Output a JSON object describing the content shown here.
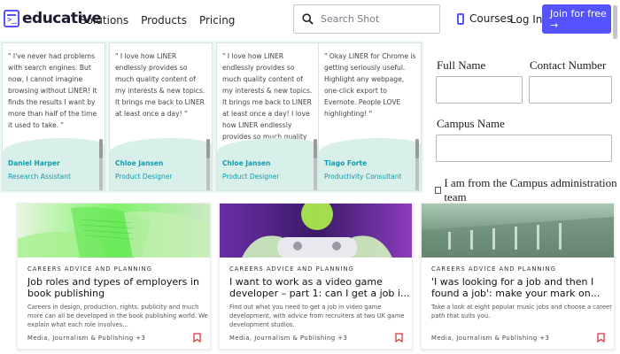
{
  "header": {
    "logo_text": "educative",
    "logo_glyph": ">_",
    "nav": [
      "Solutions",
      "Products",
      "Pricing"
    ],
    "search_placeholder": "Search Shot",
    "courses_label": "Courses",
    "login_label": "Log In",
    "join_label": "Join for free",
    "join_arrow": "→",
    "accent": "#5553ff"
  },
  "testimonials": [
    {
      "quote": "\" I've never had problems with search engines. But now, I cannot imagine browsing without LINER! It finds the results I want by more than half of the time it used to take. \"",
      "name": "Daniel Harper",
      "role": "Research Assistant"
    },
    {
      "quote": "\" I love how LINER endlessly provides so much quality content of my interests & new topics. It brings me back to LINER at least once a day! \"",
      "name": "Chloe Jansen",
      "role": "Product Designer"
    },
    {
      "quote": "\" I love how LINER endlessly provides so much quality content of my interests & new topics. It brings me back to LINER at least once a day! I love how LINER endlessly provides so much quality content of my",
      "name": "Chloe Jansen",
      "role": "Product Designer"
    },
    {
      "quote": "\" Okay LINER for Chrome is getting seriously useful. Highlight any webpage, one-click export to Evernote. People LOVE highlighting! \"",
      "name": "Tiago Forte",
      "role": "Productivity Consultant"
    }
  ],
  "form": {
    "full_name_label": "Full Name",
    "contact_label": "Contact Number",
    "campus_label": "Campus Name",
    "checkbox_label": "I am from the Campus administration team"
  },
  "articles": [
    {
      "category": "Careers advice and planning",
      "title": "Job roles and types of employers in book publishing",
      "description": "Careers in design, production, rights, publicity and much more can all be developed in the book publishing world. We explain what each role involves...",
      "tags": "Media, Journalism & Publishing +3"
    },
    {
      "category": "Careers advice and planning",
      "title": "I want to work as a video game developer – part 1: can I get a job i...",
      "description": "Find out what you need to get a job in video game development, with advice from recruiters at two UK game development studios.",
      "tags": "Media, Journalism & Publishing +3"
    },
    {
      "category": "Careers advice and planning",
      "title": "'I was looking for a job and then I found a job': make your mark on...",
      "description": "Take a look at eight popular music jobs and choose a career path that suits you.",
      "tags": "Media, Journalism & Publishing +3"
    }
  ]
}
